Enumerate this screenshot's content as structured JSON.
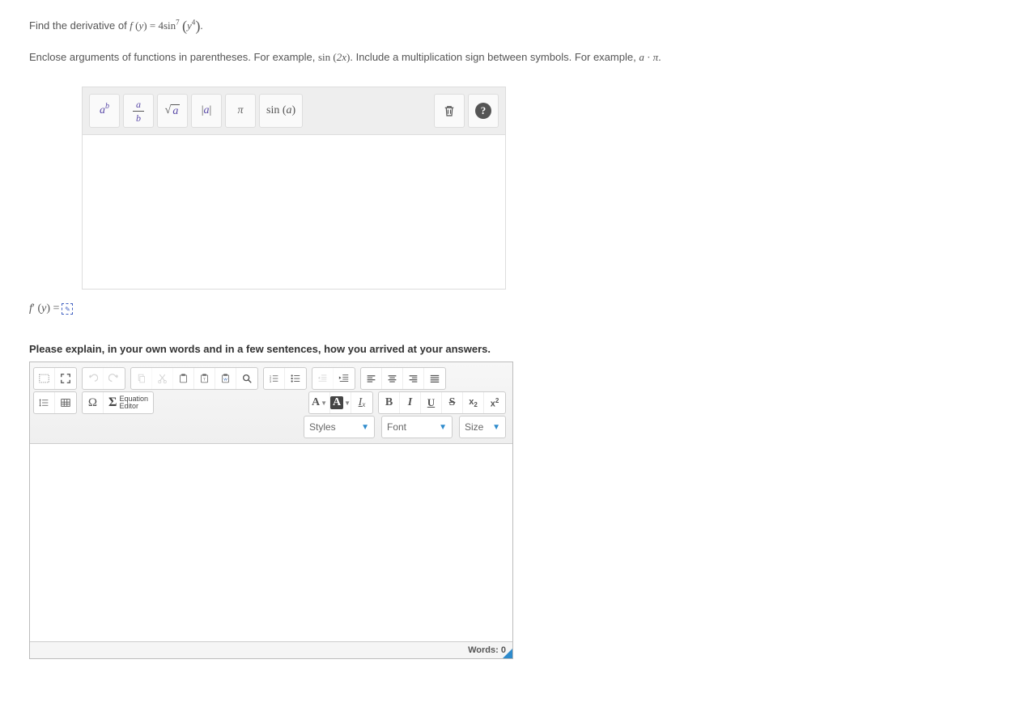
{
  "question": {
    "prefix": "Find the derivative of ",
    "func": "f",
    "var": "y",
    "coeff": "4",
    "trig": "sin",
    "outer_exp": "7",
    "inner_base": "y",
    "inner_exp": "4"
  },
  "instruction": {
    "part1": "Enclose arguments of functions in parentheses. For example, ",
    "ex1_fn": "sin",
    "ex1_arg": "2x",
    "part2": ". Include a multiplication sign between symbols. For example, ",
    "ex2_a": "a",
    "ex2_dot": "·",
    "ex2_b": "π",
    "part3": "."
  },
  "math_toolbar": {
    "exp_base": "a",
    "exp_exp": "b",
    "frac_num": "a",
    "frac_den": "b",
    "sqrt": "a",
    "abs": "a",
    "pi": "π",
    "sin_label": "sin",
    "sin_arg": "a"
  },
  "answer_prefix": {
    "func": "f",
    "prime": "′",
    "var": "y",
    "eq": "="
  },
  "explain_label": "Please explain, in your own words and in a few sentences, how you arrived at your answers.",
  "cke": {
    "eq_editor_line1": "Equation",
    "eq_editor_line2": "Editor",
    "styles": "Styles",
    "font": "Font",
    "size": "Size",
    "words_label": "Words: ",
    "words_count": "0",
    "A": "A",
    "B": "B",
    "I": "I",
    "U": "U",
    "S": "S",
    "x": "x"
  }
}
